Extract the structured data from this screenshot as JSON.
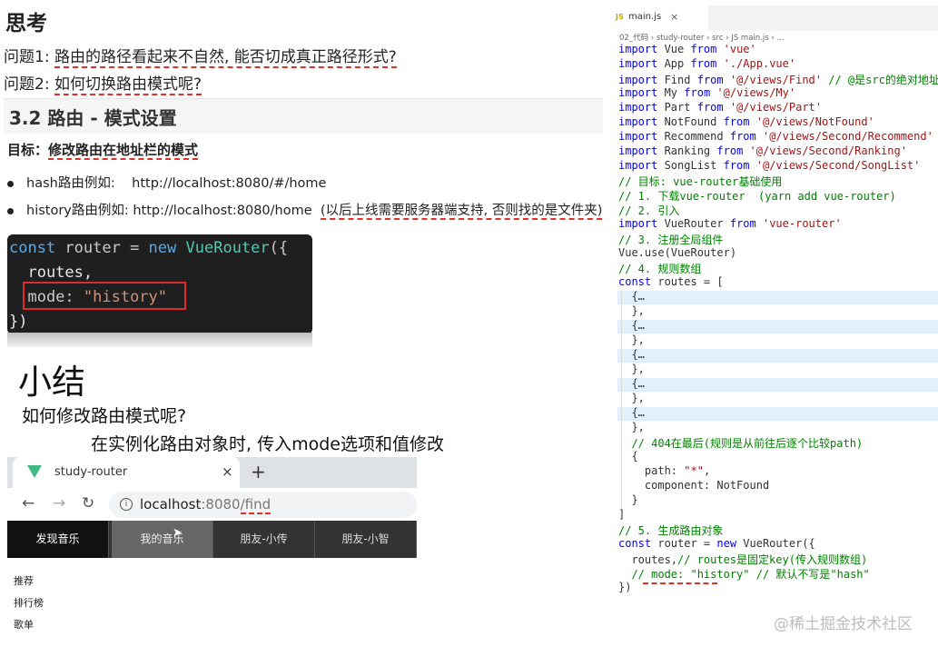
{
  "left": {
    "heading": "思考",
    "q1_prefix": "问题1: ",
    "q1_text": "路由的路径看起来不自然, 能否切成真正路径形式?",
    "q2_prefix": "问题2: ",
    "q2_text": "如何切换路由模式呢?",
    "section_title": "3.2 路由 - 模式设置",
    "goal_prefix": "目标：",
    "goal_text": "修改路由在地址栏的模式",
    "bullet1_label": "hash路由例如:",
    "bullet1_url": "http://localhost:8080/#/home",
    "bullet2_label": "history路由例如: http://localhost:8080/home",
    "bullet2_note": "(以后上线需要服务器端支持, 否则找的是文件夹)",
    "code_line1_a": "const",
    "code_line1_b": " router = ",
    "code_line1_c": "new",
    "code_line1_d": " ",
    "code_line1_e": "VueRouter",
    "code_line1_f": "({",
    "code_line2": "  routes,",
    "code_line3_key": "  mode: ",
    "code_line3_val": "\"history\"",
    "code_line4": "})",
    "summary_title": "小结",
    "summary_q": "如何修改路由模式呢?",
    "summary_a": "在实例化路由对象时, 传入mode选项和值修改"
  },
  "browser": {
    "tab_title": "study-router",
    "tab_close": "×",
    "new_tab": "+",
    "back": "←",
    "forward": "→",
    "reload": "↻",
    "info": "i",
    "url_host": "localhost",
    "url_port": ":8080",
    "url_path": "/find",
    "nav": [
      "发现音乐",
      "我的音乐",
      "朋友-小传",
      "朋友-小智"
    ],
    "side": [
      "推荐",
      "排行榜",
      "歌单"
    ]
  },
  "editor": {
    "tab_icon": "JS",
    "tab_name": "main.js",
    "tab_close": "×",
    "breadcrumb": "02_代码 › study-router › src › JS main.js › ..."
  },
  "code_lines": [
    {
      "segs": [
        [
          "import",
          "kw"
        ],
        [
          " Vue ",
          "id"
        ],
        [
          "from",
          "kw"
        ],
        [
          " ",
          "id"
        ],
        [
          "'vue'",
          "str"
        ]
      ]
    },
    {
      "segs": [
        [
          "import",
          "kw"
        ],
        [
          " App ",
          "id"
        ],
        [
          "from",
          "kw"
        ],
        [
          " ",
          "id"
        ],
        [
          "'./App.vue'",
          "str"
        ]
      ]
    },
    {
      "segs": [
        [
          "import",
          "kw"
        ],
        [
          " Find ",
          "id"
        ],
        [
          "from",
          "kw"
        ],
        [
          " ",
          "id"
        ],
        [
          "'@/views/Find'",
          "str"
        ],
        [
          " // @是src的绝对地址",
          "cm"
        ]
      ]
    },
    {
      "segs": [
        [
          "import",
          "kw"
        ],
        [
          " My ",
          "id"
        ],
        [
          "from",
          "kw"
        ],
        [
          " ",
          "id"
        ],
        [
          "'@/views/My'",
          "str"
        ]
      ]
    },
    {
      "segs": [
        [
          "import",
          "kw"
        ],
        [
          " Part ",
          "id"
        ],
        [
          "from",
          "kw"
        ],
        [
          " ",
          "id"
        ],
        [
          "'@/views/Part'",
          "str"
        ]
      ]
    },
    {
      "segs": [
        [
          "import",
          "kw"
        ],
        [
          " NotFound ",
          "id"
        ],
        [
          "from",
          "kw"
        ],
        [
          " ",
          "id"
        ],
        [
          "'@/views/NotFound'",
          "str"
        ]
      ]
    },
    {
      "segs": [
        [
          "import",
          "kw"
        ],
        [
          " Recommend ",
          "id"
        ],
        [
          "from",
          "kw"
        ],
        [
          " ",
          "id"
        ],
        [
          "'@/views/Second/Recommend'",
          "str"
        ]
      ]
    },
    {
      "segs": [
        [
          "import",
          "kw"
        ],
        [
          " Ranking ",
          "id"
        ],
        [
          "from",
          "kw"
        ],
        [
          " ",
          "id"
        ],
        [
          "'@/views/Second/Ranking'",
          "str"
        ]
      ]
    },
    {
      "segs": [
        [
          "import",
          "kw"
        ],
        [
          " SongList ",
          "id"
        ],
        [
          "from",
          "kw"
        ],
        [
          " ",
          "id"
        ],
        [
          "'@/views/Second/SongList'",
          "str"
        ]
      ]
    },
    {
      "segs": [
        [
          "// 目标: vue-router基础使用",
          "cm"
        ]
      ]
    },
    {
      "segs": [
        [
          "// 1. 下载vue-router  (yarn add vue-router)",
          "cm"
        ]
      ]
    },
    {
      "segs": [
        [
          "// 2. 引入",
          "cm"
        ]
      ]
    },
    {
      "segs": [
        [
          "import",
          "kw"
        ],
        [
          " VueRouter ",
          "id"
        ],
        [
          "from",
          "kw"
        ],
        [
          " ",
          "id"
        ],
        [
          "'vue-router'",
          "str"
        ]
      ]
    },
    {
      "segs": [
        [
          "// 3. 注册全局组件",
          "cm"
        ]
      ]
    },
    {
      "segs": [
        [
          "Vue.use(VueRouter)",
          "id"
        ]
      ]
    },
    {
      "segs": [
        [
          "// 4. 规则数组",
          "cm"
        ]
      ]
    },
    {
      "segs": [
        [
          "const",
          "kw"
        ],
        [
          " routes = [",
          "id"
        ]
      ]
    },
    {
      "segs": [
        [
          "  {…",
          "id"
        ]
      ]
    },
    {
      "segs": [
        [
          "  },",
          "id"
        ]
      ]
    },
    {
      "segs": [
        [
          "  {…",
          "id"
        ]
      ]
    },
    {
      "segs": [
        [
          "  },",
          "id"
        ]
      ]
    },
    {
      "segs": [
        [
          "  {…",
          "id"
        ]
      ]
    },
    {
      "segs": [
        [
          "  },",
          "id"
        ]
      ]
    },
    {
      "segs": [
        [
          "  {…",
          "id"
        ]
      ]
    },
    {
      "segs": [
        [
          "  },",
          "id"
        ]
      ]
    },
    {
      "segs": [
        [
          "  {…",
          "id"
        ]
      ]
    },
    {
      "segs": [
        [
          "  },",
          "id"
        ]
      ]
    },
    {
      "segs": [
        [
          "  // 404在最后(规则是从前往后逐个比较path)",
          "cm"
        ]
      ]
    },
    {
      "segs": [
        [
          "  {",
          "id"
        ]
      ]
    },
    {
      "segs": [
        [
          "    path: ",
          "id"
        ],
        [
          "\"*\"",
          "str"
        ],
        [
          ",",
          "id"
        ]
      ]
    },
    {
      "segs": [
        [
          "    component: NotFound",
          "id"
        ]
      ]
    },
    {
      "segs": [
        [
          "  }",
          "id"
        ]
      ]
    },
    {
      "segs": [
        [
          "]",
          "id"
        ]
      ]
    },
    {
      "segs": [
        [
          "// 5. 生成路由对象",
          "cm"
        ]
      ]
    },
    {
      "segs": [
        [
          "const",
          "kw"
        ],
        [
          " router = ",
          "id"
        ],
        [
          "new",
          "kw"
        ],
        [
          " VueRouter({",
          "id"
        ]
      ]
    },
    {
      "segs": [
        [
          "  routes,",
          "id"
        ],
        [
          "// routes是固定key(传入规则数组)",
          "cm"
        ]
      ]
    },
    {
      "segs": [
        [
          "  // mode: \"history\" // 默认不写是\"hash\"",
          "cm"
        ]
      ]
    },
    {
      "segs": [
        [
          "})",
          "id"
        ]
      ]
    }
  ],
  "watermark": "@稀土掘金技术社区",
  "colors": {
    "annotation_red": "#e0302a",
    "vue_green": "#41b883",
    "code_bg": "#1f1f1f"
  }
}
